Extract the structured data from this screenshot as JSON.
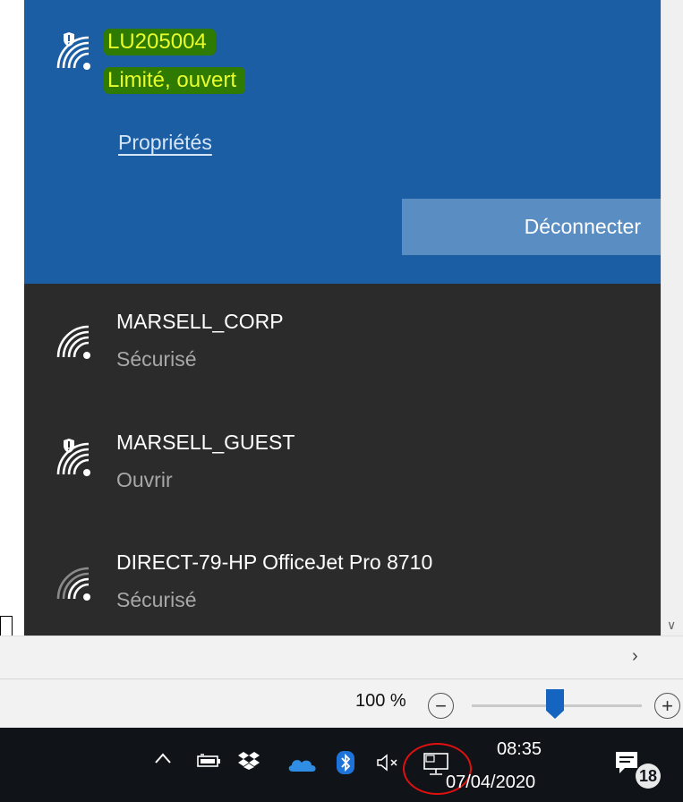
{
  "connected_network": {
    "name": "LU205004",
    "status": "Limité, ouvert",
    "properties_link": "Propriétés",
    "disconnect_button": "Déconnecter",
    "icon": "wifi-shield-icon"
  },
  "networks": [
    {
      "name": "MARSELL_CORP",
      "status": "Sécurisé",
      "icon": "wifi-icon"
    },
    {
      "name": "MARSELL_GUEST",
      "status": "Ouvrir",
      "icon": "wifi-shield-icon"
    },
    {
      "name": "DIRECT-79-HP OfficeJet Pro 8710",
      "status": "Sécurisé",
      "icon": "wifi-weak-icon"
    }
  ],
  "zoom": {
    "label": "100 %",
    "level_percent": 100,
    "minus": "−",
    "plus": "+"
  },
  "taskbar": {
    "time": "08:35",
    "date": "07/04/2020",
    "notification_count": "18",
    "tray_icons": [
      "chevron-up-icon",
      "battery-icon",
      "dropbox-icon",
      "onedrive-icon",
      "bluetooth-icon",
      "volume-muted-icon",
      "network-icon"
    ]
  },
  "colors": {
    "connected_bg": "#1b5ea4",
    "list_bg": "#2b2b2b",
    "highlight_bg": "#2f7a00",
    "highlight_text": "#e8ff2a",
    "taskbar_bg": "#101418",
    "annotation_circle": "#e01010"
  }
}
